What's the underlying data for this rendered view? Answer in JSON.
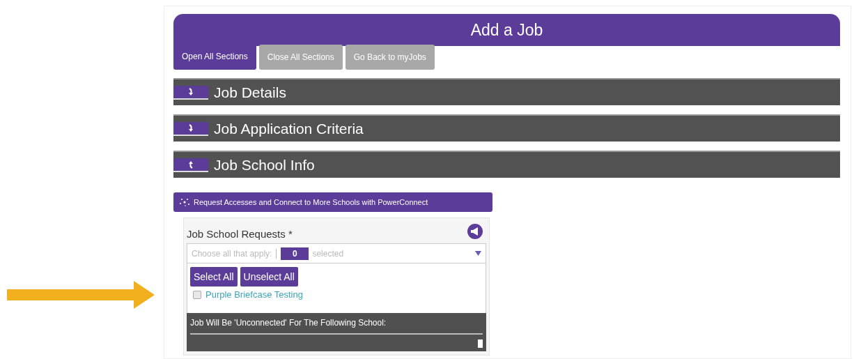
{
  "header": {
    "title": "Add a Job"
  },
  "tabs": [
    {
      "label": "Open All Sections",
      "selected": true
    },
    {
      "label": "Close All Sections",
      "selected": false
    },
    {
      "label": "Go Back to myJobs",
      "selected": false
    }
  ],
  "sections": [
    {
      "title": "Job Details",
      "expanded": false
    },
    {
      "title": "Job Application Criteria",
      "expanded": false
    },
    {
      "title": "Job School Info",
      "expanded": true
    }
  ],
  "connect_button": {
    "label": "Request Accesses and Connect to More Schools with PowerConnect"
  },
  "school_requests": {
    "label": "Job School Requests",
    "required_mark": "*",
    "placeholder": "Choose all that apply:",
    "count": "0",
    "count_suffix": "selected",
    "buttons": [
      "Select All",
      "Unselect All"
    ],
    "options": [
      {
        "label": "Purple Briefcase Testing",
        "checked": false
      }
    ],
    "footer": "Job Will Be 'Unconnected' For The Following School:"
  }
}
